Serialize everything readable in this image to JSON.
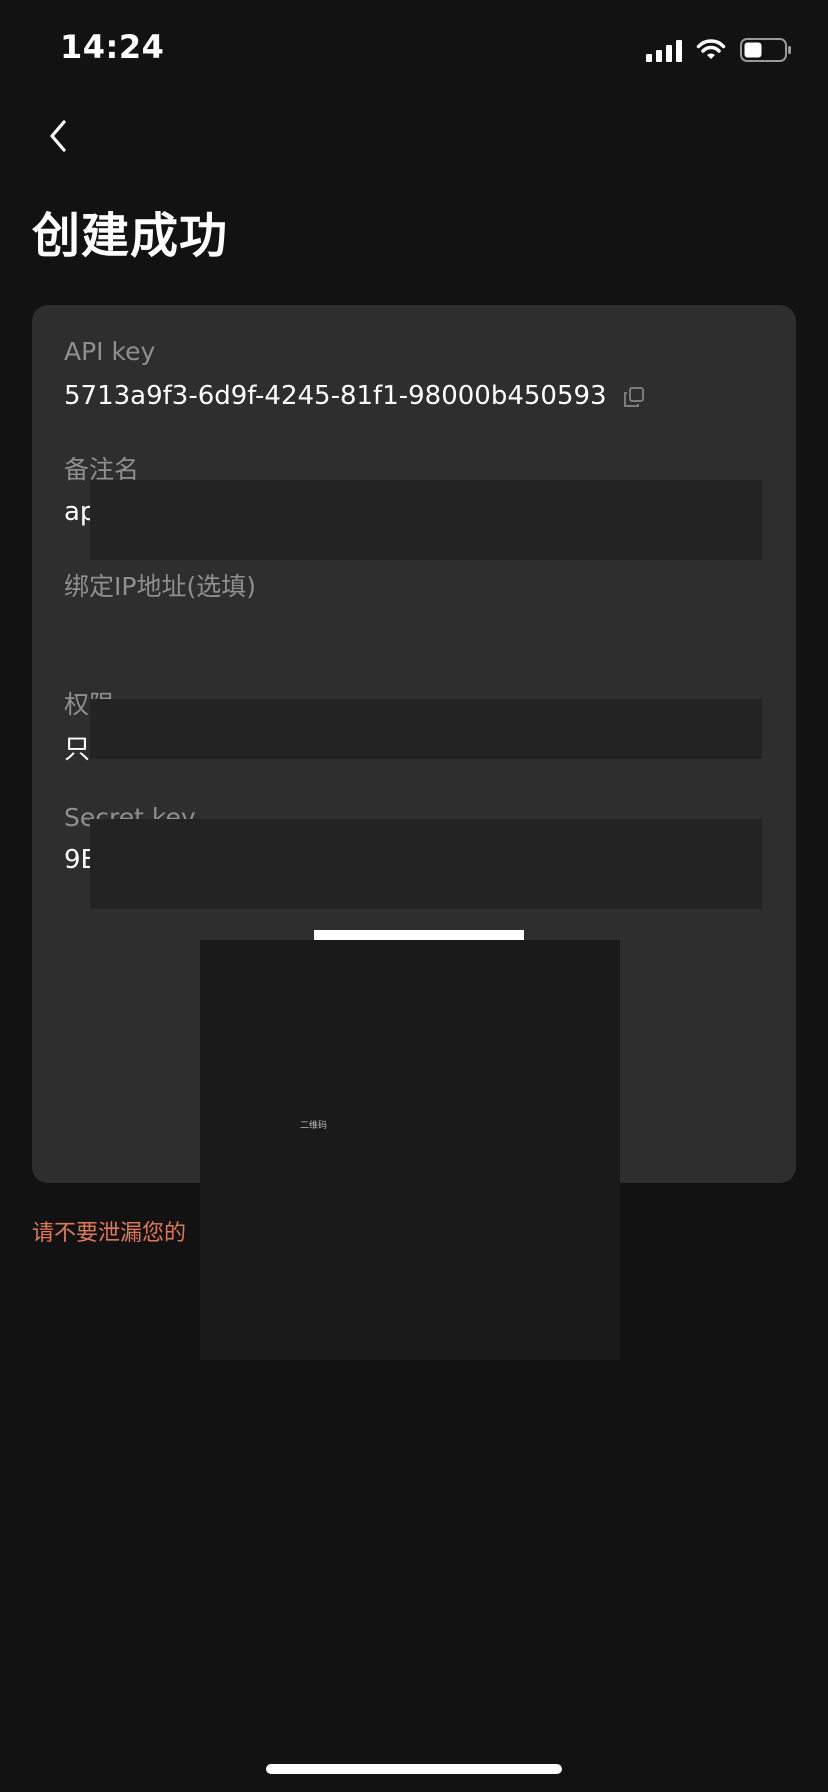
{
  "status_bar": {
    "time": "14:24",
    "signal_icon": "signal-bars-icon",
    "wifi_icon": "wifi-icon",
    "battery_icon": "battery-icon"
  },
  "nav": {
    "back_icon": "chevron-left-icon"
  },
  "title": "创建成功",
  "card": {
    "api_key": {
      "label": "API key",
      "value": "5713a9f3-6d9f-4245-81f1-98000b450593",
      "copy_icon": "copy-icon"
    },
    "remark": {
      "label": "备注名",
      "value": "ap"
    },
    "bind_ip": {
      "label": "绑定IP地址(选填)",
      "value": ""
    },
    "permission": {
      "label": "权限",
      "value": "只"
    },
    "secret_key": {
      "label": "Secret key",
      "value": "9E"
    }
  },
  "qr": {
    "caption": "二维码"
  },
  "warning": "请不要泄漏您的",
  "colors": {
    "background": "#121212",
    "card": "#2e2e2e",
    "label": "#8f8f8f",
    "warning": "#e07858",
    "redaction": "#232323"
  }
}
